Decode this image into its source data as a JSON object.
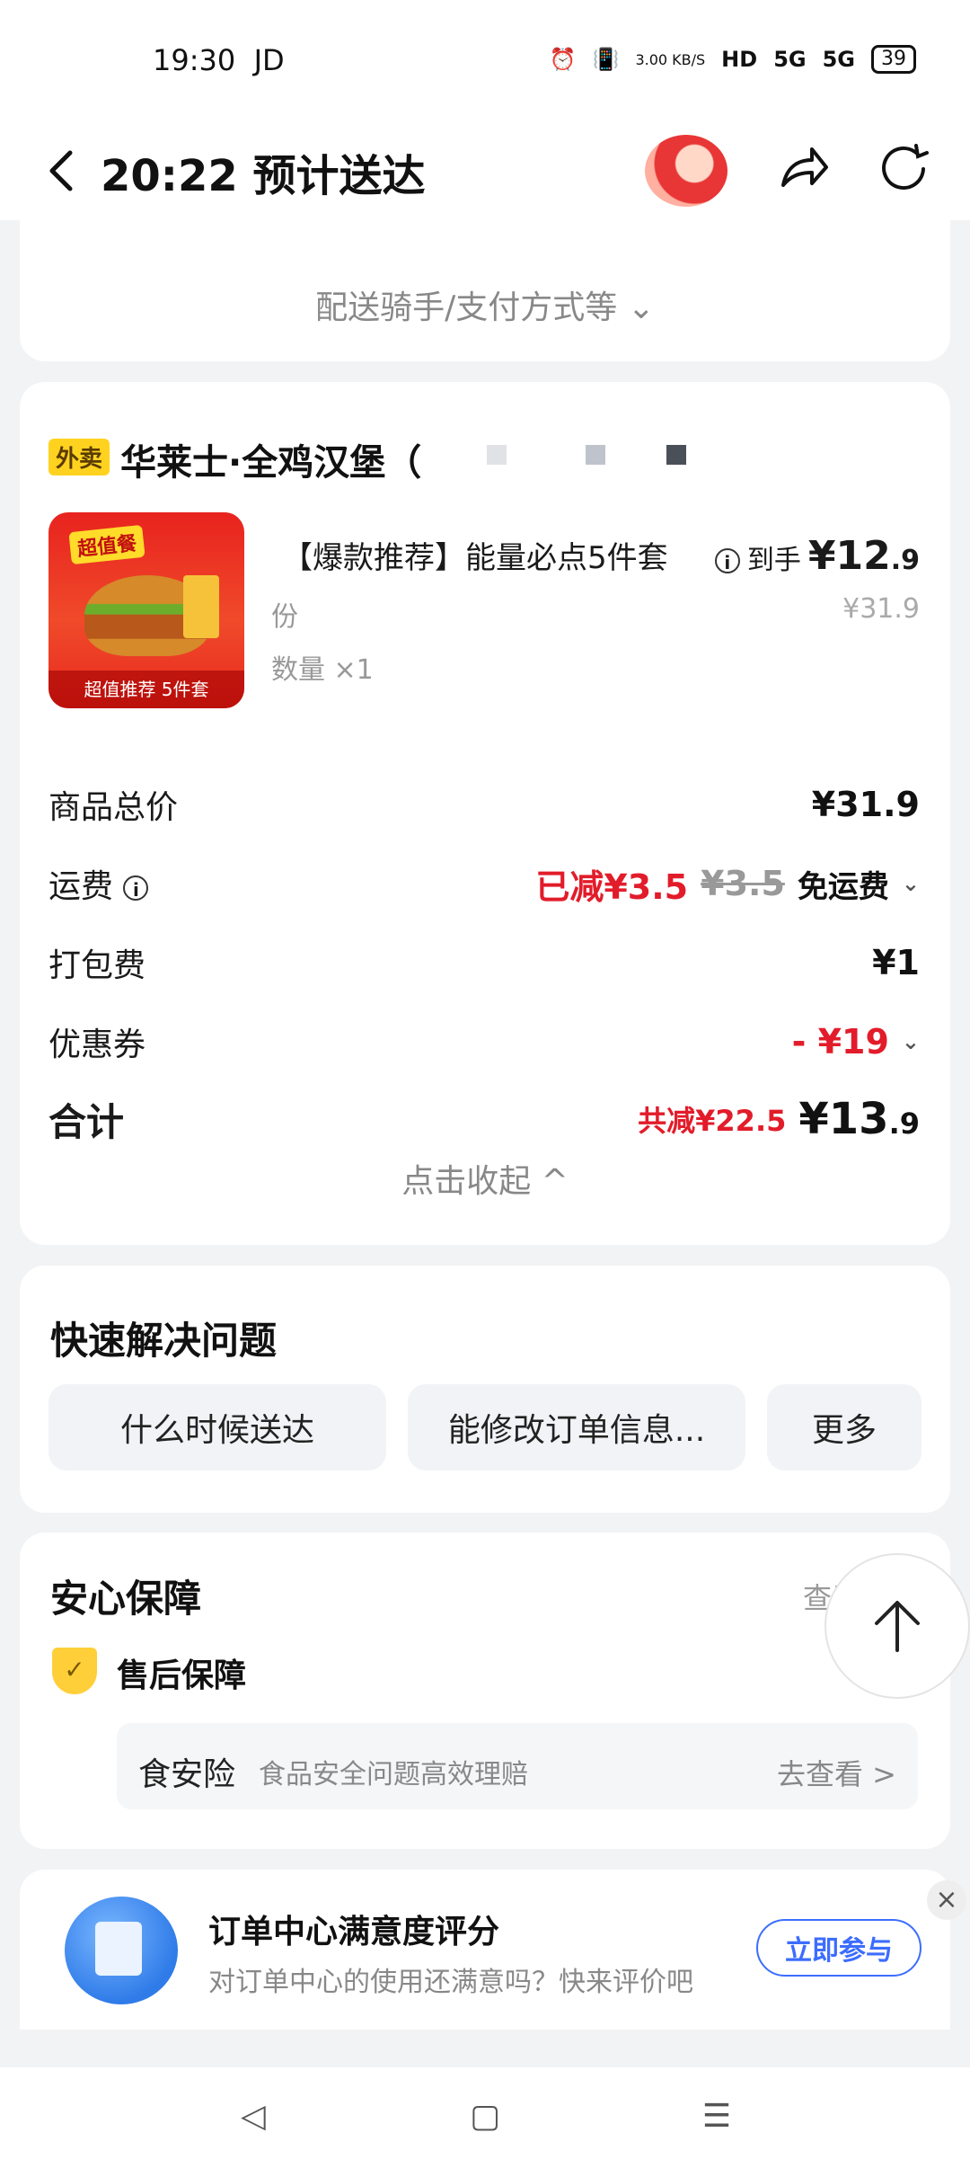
{
  "status_bar": {
    "time": "19:30",
    "carrier": "JD",
    "net_speed": "3.00 KB/S",
    "hd": "HD",
    "signal1": "5G",
    "signal2": "5G",
    "battery": "39"
  },
  "header": {
    "title": "20:22 预计送达"
  },
  "top_card": {
    "delivery_toggle": "配送骑手/支付方式等 ⌄"
  },
  "order": {
    "tag": "外卖",
    "store_name": "华莱士·全鸡汉堡（",
    "product": {
      "badge": "超值餐",
      "caption": "超值推荐 5件套",
      "name": "【爆款推荐】能量必点5件套",
      "unit": "份",
      "qty": "数量 ×1",
      "price_label": "到手",
      "price_big": "¥12",
      "price_small": ".9",
      "orig_price": "¥31.9"
    },
    "fees": {
      "subtotal_label": "商品总价",
      "subtotal_value": "¥31.9",
      "shipping_label": "运费",
      "shipping_saved": "已减¥3.5",
      "shipping_orig": "¥3.5",
      "shipping_value": "免运费",
      "packing_label": "打包费",
      "packing_value": "¥1",
      "coupon_label": "优惠券",
      "coupon_value": "- ¥19",
      "total_label": "合计",
      "total_saved": "共减¥22.5",
      "total_big": "¥13",
      "total_small": ".9"
    },
    "collapse": "点击收起 ^"
  },
  "quick": {
    "title": "快速解决问题",
    "buttons": [
      "什么时候送达",
      "能修改订单信息...",
      "更多"
    ]
  },
  "guarantee": {
    "title": "安心保障",
    "see_all": "查看全部",
    "after_sale": "售后保障",
    "food_title": "食安险",
    "food_desc": "食品安全问题高效理赔",
    "food_link": "去查看 >"
  },
  "rating": {
    "title": "订单中心满意度评分",
    "subtitle": "对订单中心的使用还满意吗？快来评价吧",
    "button": "立即参与"
  },
  "colors": {
    "accent_red": "#e21c2a",
    "accent_blue": "#3c6dff",
    "tag_yellow": "#ffd21f"
  }
}
